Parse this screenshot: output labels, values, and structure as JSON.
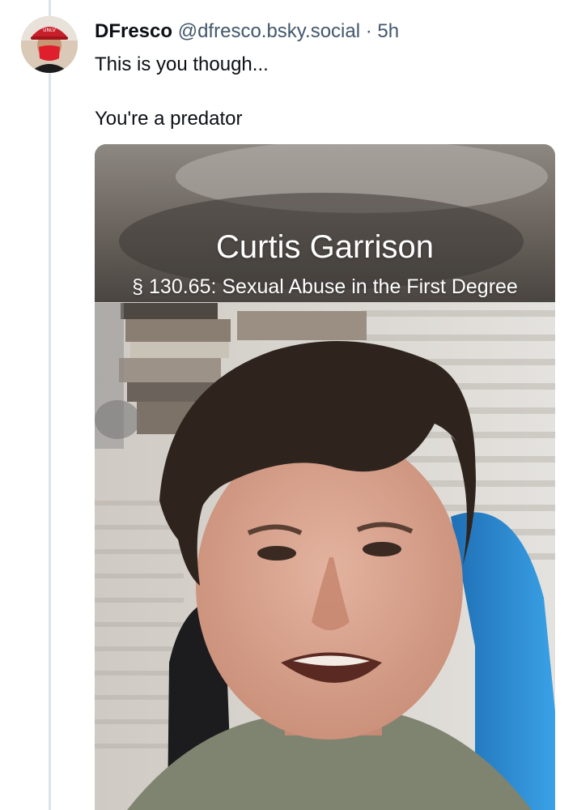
{
  "post": {
    "author": {
      "display_name": "DFresco",
      "handle": "@dfresco.bsky.social",
      "avatar_icon": "user-avatar"
    },
    "separator": "·",
    "timestamp": "5h",
    "text_lines": [
      "This is you though...",
      "You're a predator"
    ]
  },
  "media": {
    "overlay_name": "Curtis Garrison",
    "overlay_charge": "§ 130.65: Sexual Abuse in the First Degree"
  },
  "colors": {
    "thread_line": "#dde3ea",
    "secondary_text": "#42576c",
    "primary_text": "#0b0f14",
    "chair_blue": "#2f8fd6"
  }
}
